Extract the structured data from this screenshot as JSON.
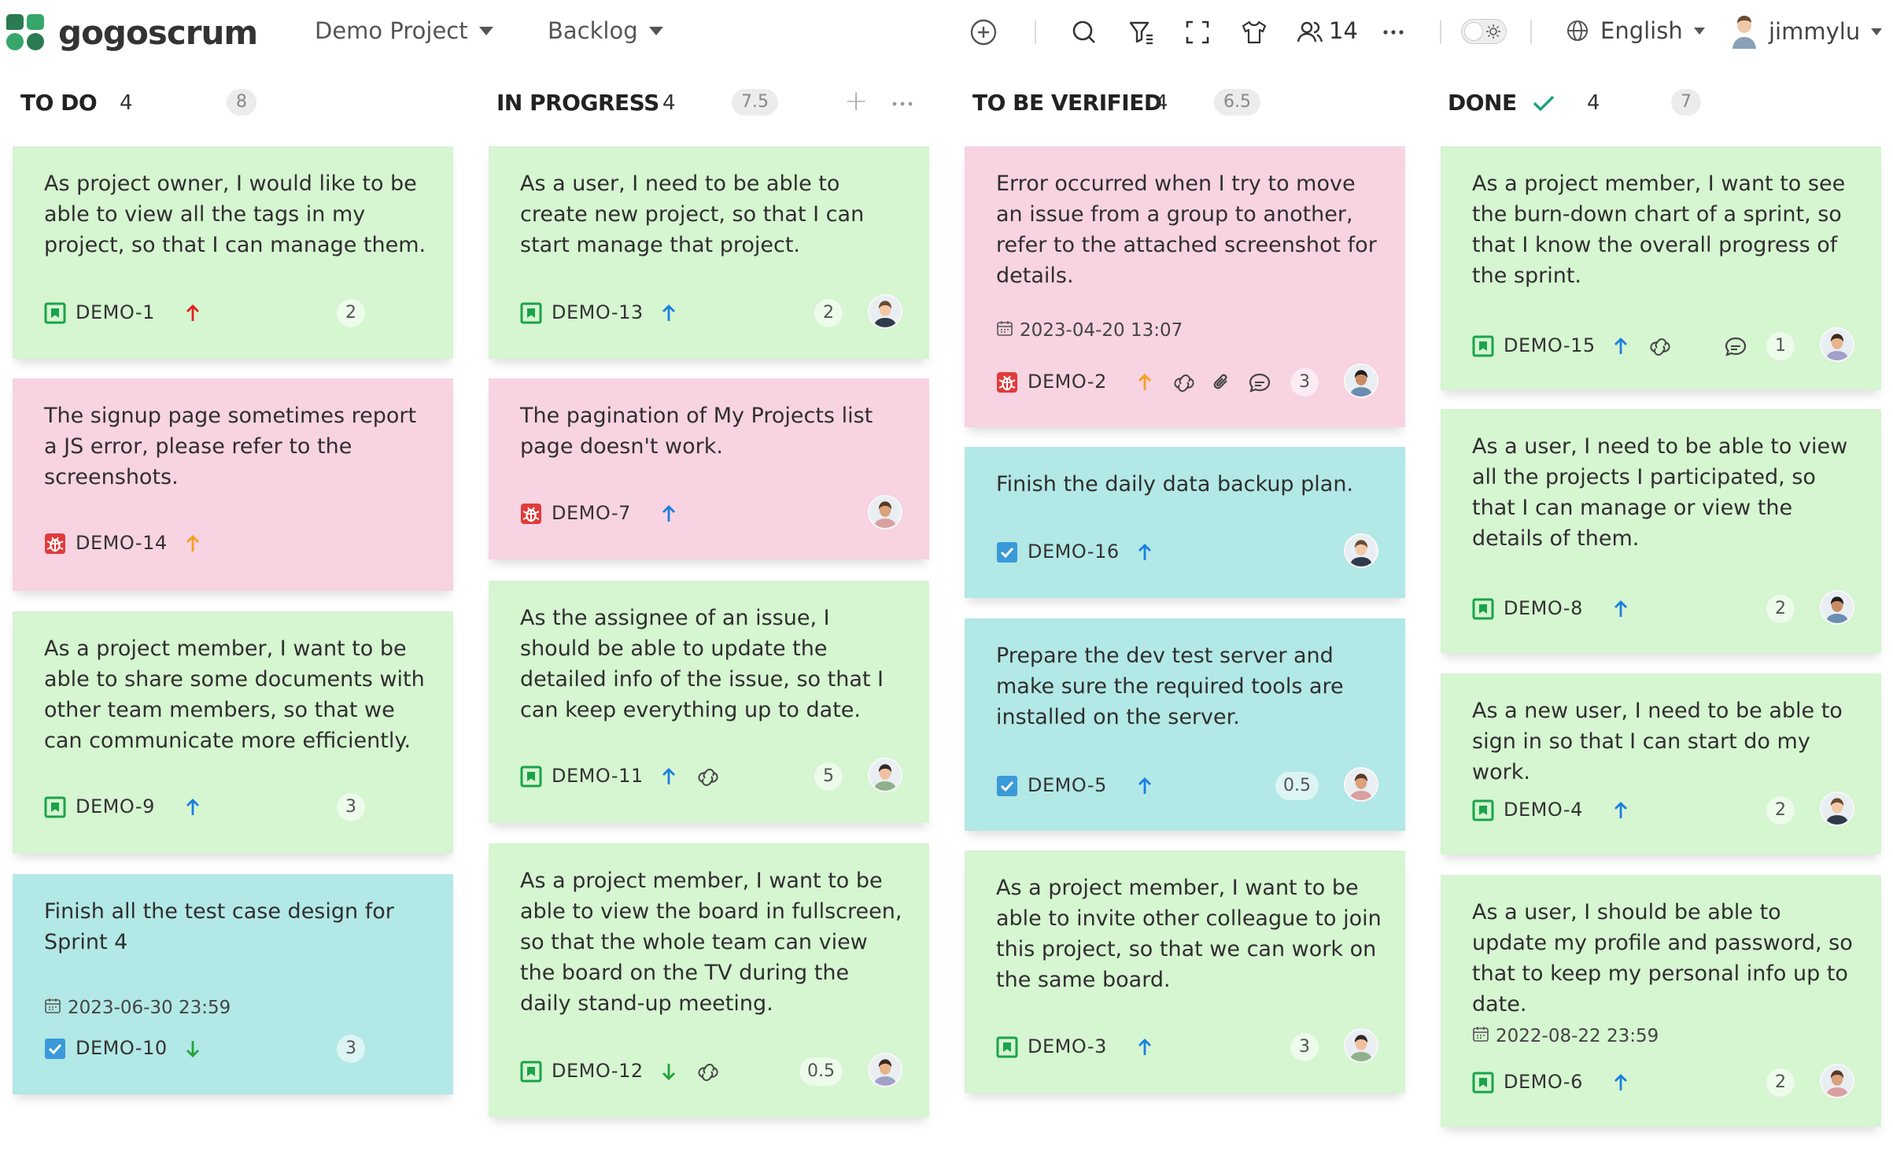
{
  "app": {
    "name": "gogoscrum"
  },
  "header": {
    "project": "Demo Project",
    "view": "Backlog",
    "members_count": "14",
    "language": "English",
    "user": "jimmylu"
  },
  "colors": {
    "story": "#d6f5d1",
    "bug": "#f8d3e2",
    "task": "#b2e8e6",
    "accent": "#2a9d6a"
  },
  "columns": [
    {
      "title": "TO DO",
      "count": "4",
      "points": "8",
      "cards": [
        {
          "type": "story",
          "title": "As project owner, I would like to be able to view all the tags in my project, so that I can manage them.",
          "key": "DEMO-1",
          "priority": "highest",
          "points": "2",
          "avatar": false
        },
        {
          "type": "bug",
          "title": "The signup page sometimes report a JS error, please refer to the screenshots.",
          "key": "DEMO-14",
          "priority": "high",
          "avatar": false
        },
        {
          "type": "story",
          "title": "As a project member, I want to be able to share some documents with other team members, so that we can communicate more efficiently.",
          "key": "DEMO-9",
          "priority": "medium",
          "points": "3",
          "avatar": false
        },
        {
          "type": "task",
          "title": "Finish all the test case design for Sprint 4",
          "date": "2023-06-30 23:59",
          "key": "DEMO-10",
          "priority": "low",
          "points": "3",
          "avatar": false
        }
      ]
    },
    {
      "title": "IN PROGRESS",
      "count": "4",
      "points": "7.5",
      "cards": [
        {
          "type": "story",
          "title": "As a user, I need to be able to create new project, so that I can start manage that project.",
          "key": "DEMO-13",
          "priority": "medium",
          "points": "2",
          "avatar": true
        },
        {
          "type": "bug",
          "title": "The pagination of My Projects list page doesn't work.",
          "key": "DEMO-7",
          "priority": "medium",
          "avatar": true
        },
        {
          "type": "story",
          "title": "As the assignee of an issue, I should be able to update the detailed info of the issue, so that I can keep everything up to date.",
          "key": "DEMO-11",
          "priority": "medium",
          "links": true,
          "points": "5",
          "avatar": true
        },
        {
          "type": "story",
          "title": "As a project member, I want to be able to view the board in fullscreen, so that the whole team can view the board on the TV during the daily stand-up meeting.",
          "key": "DEMO-12",
          "priority": "low",
          "links": true,
          "points": "0.5",
          "avatar": true
        }
      ]
    },
    {
      "title": "TO BE VERIFIED",
      "count": "4",
      "points": "6.5",
      "cards": [
        {
          "type": "bug",
          "title": "Error occurred when I try to move an issue from a group to another, refer to the attached screenshot for details.",
          "date": "2023-04-20 13:07",
          "key": "DEMO-2",
          "priority": "high",
          "links": true,
          "attachment": true,
          "comments": true,
          "points": "3",
          "avatar": true
        },
        {
          "type": "task",
          "title": "Finish the daily data backup plan.",
          "key": "DEMO-16",
          "priority": "medium",
          "avatar": true
        },
        {
          "type": "task",
          "title": "Prepare the dev test server and make sure the required tools are installed on the server.",
          "key": "DEMO-5",
          "priority": "medium",
          "points": "0.5",
          "avatar": true
        },
        {
          "type": "story",
          "title": "As a project member, I want to be able to invite other colleague to join this project, so that we can work on the same board.",
          "key": "DEMO-3",
          "priority": "medium",
          "points": "3",
          "avatar": true
        }
      ]
    },
    {
      "title": "DONE",
      "count": "4",
      "points": "7",
      "cards": [
        {
          "type": "story",
          "title": "As a project member, I want to see the burn-down chart of a sprint, so that I know the overall progress of the sprint.",
          "key": "DEMO-15",
          "priority": "medium",
          "links": true,
          "comments": true,
          "points": "1",
          "avatar": true
        },
        {
          "type": "story",
          "title": "As a user, I need to be able to view all the projects I participated, so that I can manage or view the details of them.",
          "key": "DEMO-8",
          "priority": "medium",
          "points": "2",
          "avatar": true
        },
        {
          "type": "story",
          "title": "As a new user, I need to be able to sign in so that I can start do my work.",
          "key": "DEMO-4",
          "priority": "medium",
          "points": "2",
          "avatar": true
        },
        {
          "type": "story",
          "title": "As a user, I should be able to update my profile and password, so that to keep my personal info up to date.",
          "date": "2022-08-22 23:59",
          "key": "DEMO-6",
          "priority": "medium",
          "points": "2",
          "avatar": true
        }
      ]
    }
  ]
}
